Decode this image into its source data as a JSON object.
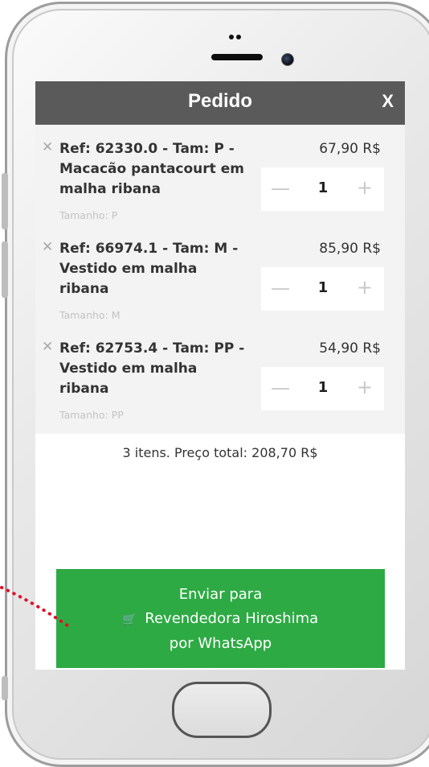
{
  "modal": {
    "title": "Pedido",
    "close_label": "X"
  },
  "cart_items": [
    {
      "title": "Ref: 62330.0 - Tam: P - Macacão pantacourt em malha ribana",
      "size_label": "Tamanho: P",
      "price": "67,90 R$",
      "quantity": "1"
    },
    {
      "title": "Ref: 66974.1 - Tam: M - Vestido em malha ribana",
      "size_label": "Tamanho: M",
      "price": "85,90 R$",
      "quantity": "1"
    },
    {
      "title": "Ref: 62753.4 - Tam: PP - Vestido em malha ribana",
      "size_label": "Tamanho: PP",
      "price": "54,90 R$",
      "quantity": "1"
    }
  ],
  "summary": {
    "total_text": "3 itens. Preço total: 208,70 R$"
  },
  "send_button": {
    "line1": "Enviar para",
    "line2": "Revendedora Hiroshima",
    "line3": "por WhatsApp",
    "icon": "cart-icon"
  },
  "colors": {
    "header_bg": "#5a5a5a",
    "button_green": "#2eaa44",
    "pointer_red": "#e0102a"
  }
}
